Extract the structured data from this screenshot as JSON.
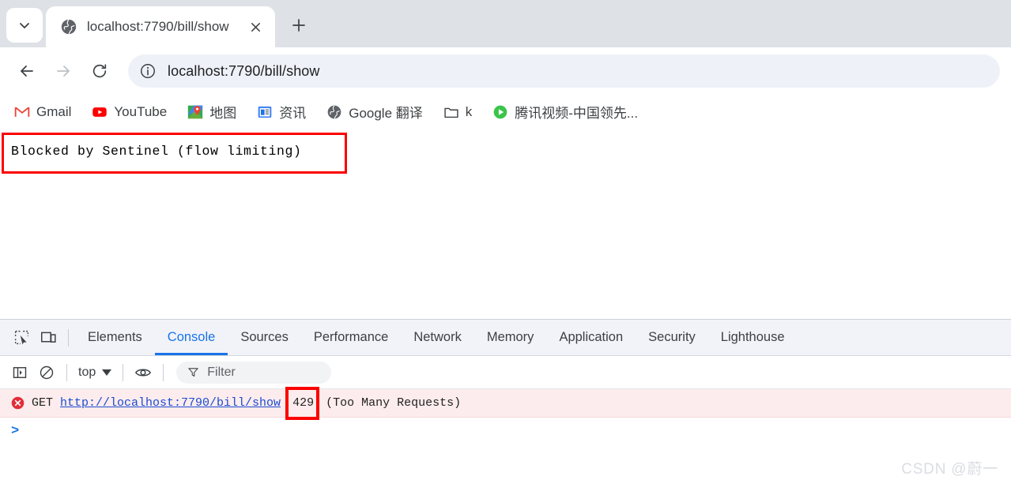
{
  "browser": {
    "tab_search_icon": "chevron-down-icon",
    "tab": {
      "favicon": "globe-icon",
      "title": "localhost:7790/bill/show",
      "close_icon": "close-icon"
    },
    "new_tab_icon": "plus-icon",
    "toolbar": {
      "back_icon": "arrow-left-icon",
      "forward_icon": "arrow-right-icon",
      "reload_icon": "reload-icon",
      "site_info_icon": "info-circle-icon",
      "url": "localhost:7790/bill/show"
    },
    "bookmarks": [
      {
        "label": "Gmail",
        "icon": "gmail-icon"
      },
      {
        "label": "YouTube",
        "icon": "youtube-icon"
      },
      {
        "label": "地图",
        "icon": "google-maps-icon"
      },
      {
        "label": "资讯",
        "icon": "google-news-icon"
      },
      {
        "label": "Google 翻译",
        "icon": "globe-icon"
      },
      {
        "label": "k",
        "icon": "folder-icon"
      },
      {
        "label": "腾讯视频-中国领先...",
        "icon": "tencent-video-icon"
      }
    ]
  },
  "page": {
    "body_text": "Blocked by Sentinel (flow limiting)",
    "annotation_color": "#fc0000"
  },
  "devtools": {
    "inspect_icon": "inspect-element-icon",
    "device_icon": "device-toolbar-icon",
    "tabs": [
      {
        "label": "Elements",
        "active": false
      },
      {
        "label": "Console",
        "active": true
      },
      {
        "label": "Sources",
        "active": false
      },
      {
        "label": "Performance",
        "active": false
      },
      {
        "label": "Network",
        "active": false
      },
      {
        "label": "Memory",
        "active": false
      },
      {
        "label": "Application",
        "active": false
      },
      {
        "label": "Security",
        "active": false
      },
      {
        "label": "Lighthouse",
        "active": false
      }
    ],
    "console_toolbar": {
      "sidebar_icon": "console-sidebar-icon",
      "clear_icon": "clear-console-icon",
      "context": "top",
      "context_caret": "chevron-down-icon",
      "eye_icon": "live-expression-icon",
      "filter_icon": "filter-icon",
      "filter_placeholder": "Filter"
    },
    "console_messages": [
      {
        "icon": "error-icon",
        "method": "GET",
        "url": "http://localhost:7790/bill/show",
        "status": "429",
        "status_text": "(Too Many Requests)",
        "highlight": true
      }
    ],
    "prompt_symbol": ">"
  },
  "watermark": "CSDN @蔚一",
  "accent": {
    "devtools_blue": "#1a73e8",
    "error_bg": "#fdeced",
    "link_blue": "#1a4bd1"
  }
}
